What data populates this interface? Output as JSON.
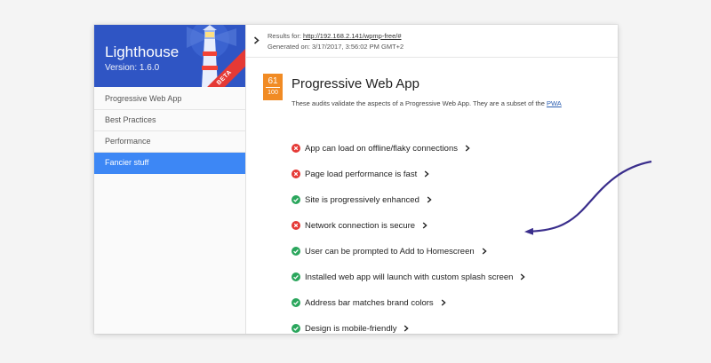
{
  "sidebar": {
    "title": "Lighthouse",
    "version": "Version: 1.6.0",
    "beta": "BETA",
    "items": [
      {
        "label": "Progressive Web App"
      },
      {
        "label": "Best Practices"
      },
      {
        "label": "Performance"
      },
      {
        "label": "Fancier stuff"
      }
    ],
    "active_index": 3
  },
  "header": {
    "results_label": "Results for:",
    "url": "http://192.168.2.141/wpmp-free/#",
    "generated": "Generated on: 3/17/2017, 3:56:02 PM GMT+2"
  },
  "section": {
    "score": "61",
    "score_max": "100",
    "title": "Progressive Web App",
    "description": "These audits validate the aspects of a Progressive Web App. They are a subset of the",
    "link_text": "PWA"
  },
  "audits": [
    {
      "label": "App can load on offline/flaky connections",
      "status": "fail"
    },
    {
      "label": "Page load performance is fast",
      "status": "fail"
    },
    {
      "label": "Site is progressively enhanced",
      "status": "pass"
    },
    {
      "label": "Network connection is secure",
      "status": "fail"
    },
    {
      "label": "User can be prompted to Add to Homescreen",
      "status": "pass"
    },
    {
      "label": "Installed web app will launch with custom splash screen",
      "status": "pass"
    },
    {
      "label": "Address bar matches brand colors",
      "status": "pass"
    },
    {
      "label": "Design is mobile-friendly",
      "status": "pass"
    }
  ],
  "icons": {
    "pass": "check-circle-icon",
    "fail": "x-circle-icon",
    "expand": "chevron-right-icon"
  },
  "colors": {
    "brand": "#2f55c4",
    "active_nav": "#3d87f5",
    "score": "#f18b24",
    "pass": "#2aa65c",
    "fail": "#e53935",
    "annotation_arrow": "#3a2e8c"
  }
}
